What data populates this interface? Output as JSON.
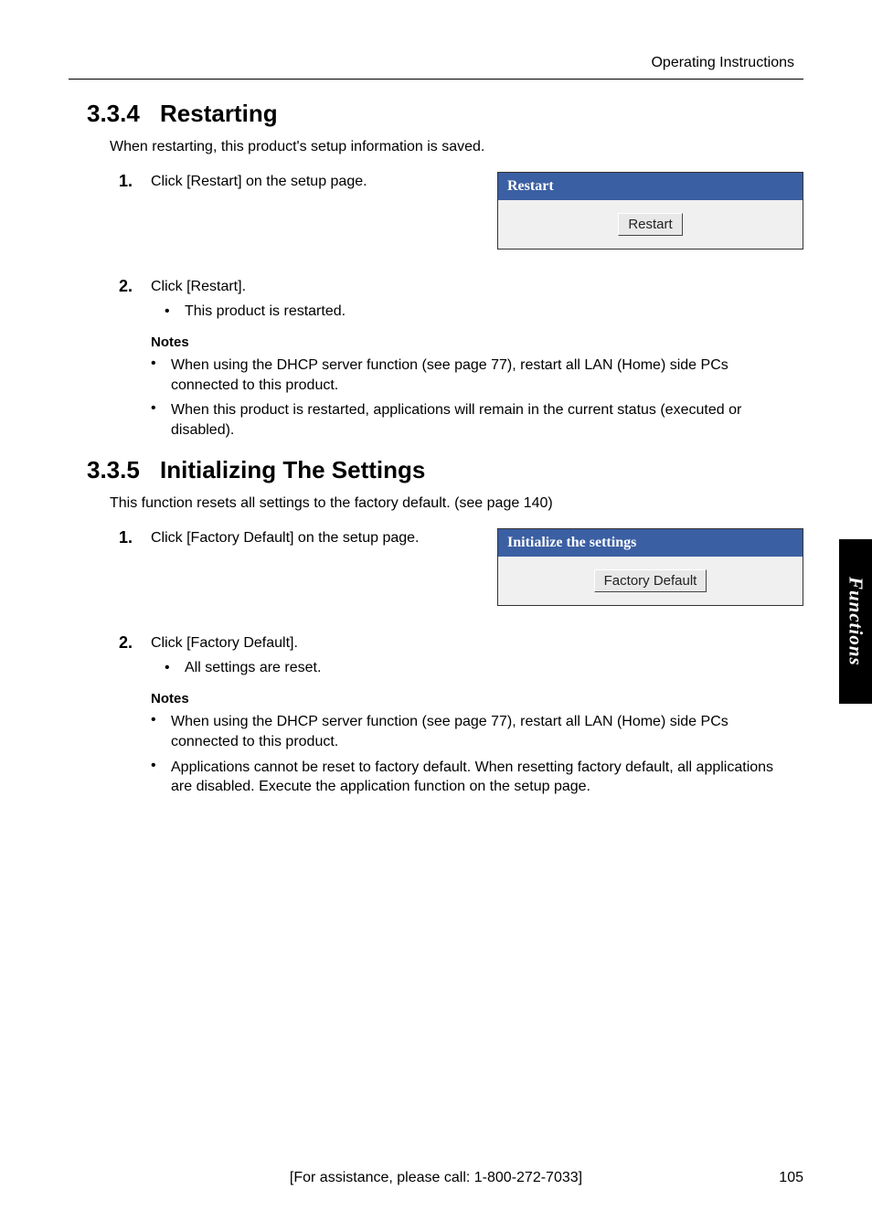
{
  "header": {
    "right_text": "Operating Instructions"
  },
  "section1": {
    "number": "3.3.4",
    "title": "Restarting",
    "intro": "When restarting, this product's setup information is saved.",
    "step1_num": "1.",
    "step1_text": "Click [Restart] on the setup page.",
    "panel_header": "Restart",
    "panel_button": "Restart",
    "step2_num": "2.",
    "step2_text": "Click [Restart].",
    "step2_sub": "This product is restarted.",
    "notes_heading": "Notes",
    "note1": "When using the DHCP server function (see page 77), restart all LAN (Home) side PCs connected to this product.",
    "note2": "When this product is restarted, applications will remain in the current status (executed or disabled)."
  },
  "section2": {
    "number": "3.3.5",
    "title": "Initializing The Settings",
    "intro": "This function resets all settings to the factory default. (see page 140)",
    "step1_num": "1.",
    "step1_text": "Click [Factory Default] on the setup page.",
    "panel_header": "Initialize the settings",
    "panel_button": "Factory Default",
    "step2_num": "2.",
    "step2_text": "Click [Factory Default].",
    "step2_sub": "All settings are reset.",
    "notes_heading": "Notes",
    "note1": "When using the DHCP server function (see page 77), restart all LAN (Home) side PCs connected to this product.",
    "note2": "Applications cannot be reset to factory default. When resetting factory default, all applications are disabled. Execute the application function on the setup page."
  },
  "sidebar": {
    "label": "Functions"
  },
  "footer": {
    "center": "[For assistance, please call: 1-800-272-7033]",
    "page": "105"
  }
}
